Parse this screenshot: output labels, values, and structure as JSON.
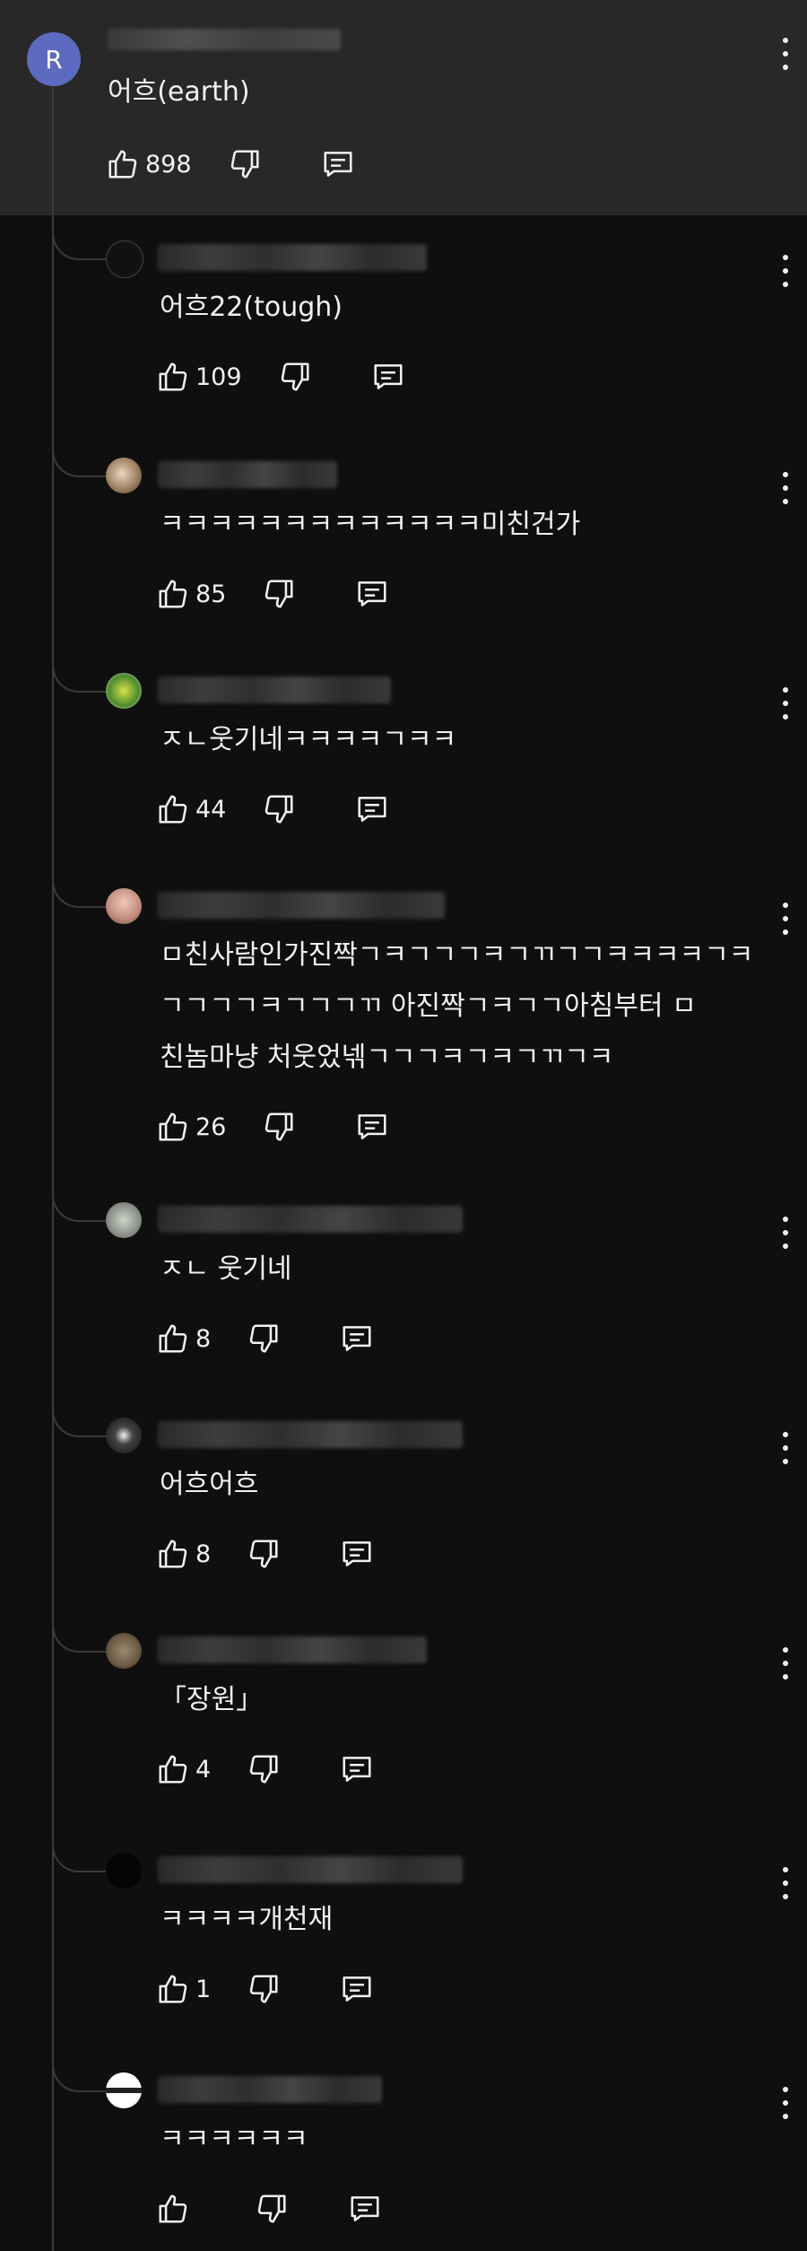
{
  "main_comment": {
    "avatar_letter": "R",
    "avatar_color": "#5c6bc0",
    "text": "어흐(earth)",
    "like_count": "898"
  },
  "replies": [
    {
      "text": "어흐22(tough)",
      "like_count": "109"
    },
    {
      "text": "ㅋㅋㅋㅋㅋㅋㅋㅋㅋㅋㅋㅋㅋ미친건가",
      "like_count": "85"
    },
    {
      "text": "ㅈㄴ웃기네ㅋㅋㅋㅋㄱㅋㅋ",
      "like_count": "44"
    },
    {
      "text": "ㅁ친사람인가진짝ㄱㅋㄱㄱㄱㅋㄱㄲㄱㄱㅋㅋㅋㅋㄱㅋ\nㄱㄱㄱㄱㅋㄱㄱㄱㄲ 아진짝ㄱㅋㄱㄱ아침부터 ㅁ\n친놈마냥 처웃었넦ㄱㄱㄱㅋㄱㅋㄱㄲㄱㅋ",
      "like_count": "26"
    },
    {
      "text": "ㅈㄴ 웃기네",
      "like_count": "8"
    },
    {
      "text": "어흐어흐",
      "like_count": "8"
    },
    {
      "text": "「장원」",
      "like_count": "4"
    },
    {
      "text": "ㅋㅋㅋㅋ개천재",
      "like_count": "1"
    },
    {
      "text": "ㅋㅋㅋㅋㅋㅋ",
      "like_count": ""
    }
  ],
  "icons": {
    "like": "thumbs-up-icon",
    "dislike": "thumbs-down-icon",
    "reply": "reply-comment-icon",
    "more": "more-vertical-icon"
  }
}
